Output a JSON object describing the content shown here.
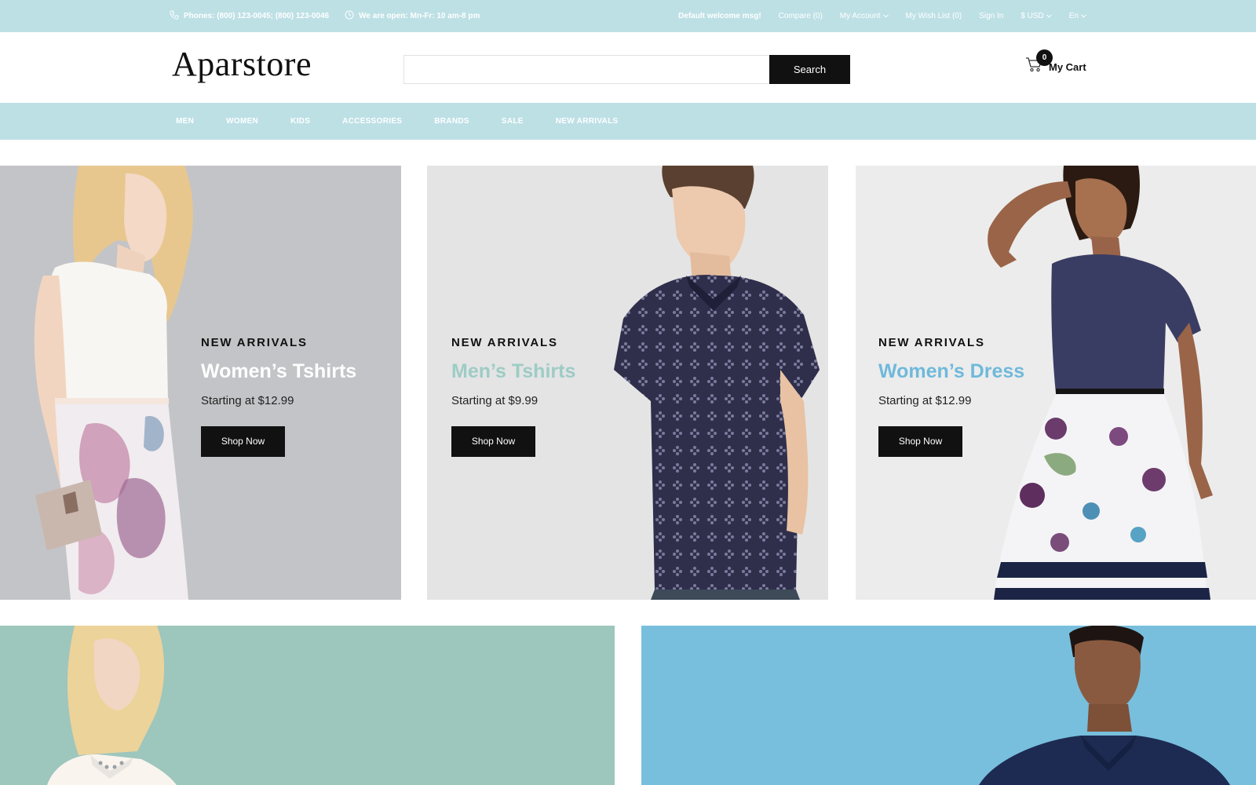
{
  "topbar": {
    "phones": "Phones: (800) 123-0045; (800) 123-0046",
    "hours": "We are open: Mn-Fr: 10 am-8 pm",
    "welcome": "Default welcome msg!",
    "compare": "Compare (0)",
    "account": "My Account",
    "wishlist": "My Wish List (0)",
    "signin": "Sign In",
    "currency": "$ USD",
    "language": "En",
    "colors": {
      "background": "#bde0e5",
      "text": "#ffffff"
    }
  },
  "header": {
    "logo": "Aparstore",
    "search": {
      "placeholder": "",
      "value": "",
      "button": "Search"
    },
    "cart": {
      "label": "My Cart",
      "count": "0"
    }
  },
  "nav": {
    "items": [
      {
        "label": "MEN"
      },
      {
        "label": "WOMEN"
      },
      {
        "label": "KIDS"
      },
      {
        "label": "ACCESSORIES"
      },
      {
        "label": "BRANDS"
      },
      {
        "label": "SALE"
      },
      {
        "label": "NEW ARRIVALS"
      }
    ]
  },
  "banners": [
    {
      "eyebrow": "NEW ARRIVALS",
      "title": "Women’s Tshirts",
      "price": "Starting at $12.99",
      "button": "Shop Now",
      "title_color": "#ffffff"
    },
    {
      "eyebrow": "NEW ARRIVALS",
      "title": "Men’s Tshirts",
      "price": "Starting at $9.99",
      "button": "Shop Now",
      "title_color": "#9dccc5"
    },
    {
      "eyebrow": "NEW ARRIVALS",
      "title": "Women’s Dress",
      "price": "Starting at $12.99",
      "button": "Shop Now",
      "title_color": "#6fb9db"
    }
  ],
  "icons": [
    "phone-icon",
    "clock-icon",
    "chevron-down-icon",
    "cart-icon"
  ],
  "colors": {
    "accent_dark": "#111111",
    "teal_tile": "#9dc6bd",
    "blue_tile": "#78bfdd"
  }
}
